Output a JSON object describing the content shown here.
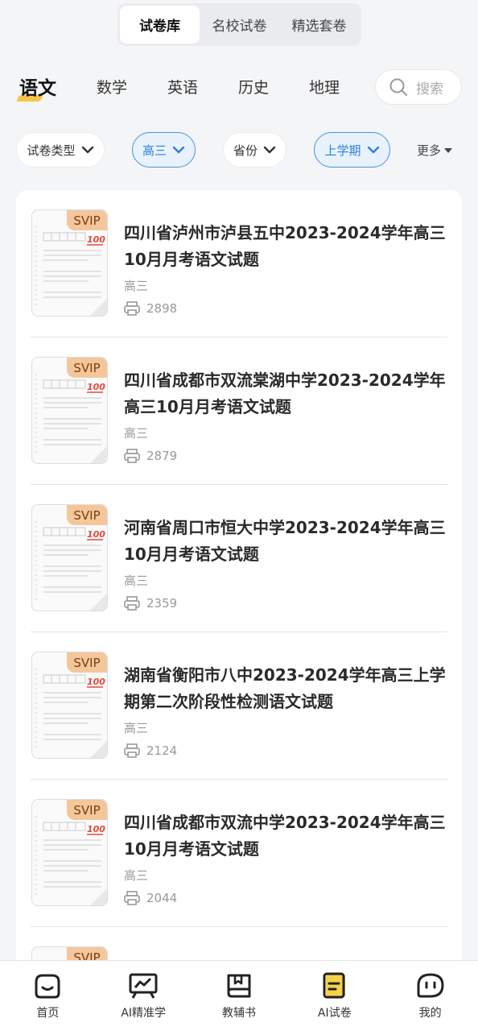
{
  "segment_tabs": [
    {
      "label": "试卷库",
      "active": true
    },
    {
      "label": "名校试卷",
      "active": false
    },
    {
      "label": "精选套卷",
      "active": false
    }
  ],
  "subjects": [
    {
      "label": "语文",
      "active": true
    },
    {
      "label": "数学",
      "active": false
    },
    {
      "label": "英语",
      "active": false
    },
    {
      "label": "历史",
      "active": false
    },
    {
      "label": "地理",
      "active": false
    }
  ],
  "search": {
    "placeholder": "搜索",
    "icon": "search-icon"
  },
  "filters": [
    {
      "label": "试卷类型",
      "selected": false
    },
    {
      "label": "高三",
      "selected": true
    },
    {
      "label": "省份",
      "selected": false
    },
    {
      "label": "上学期",
      "selected": true
    }
  ],
  "more_label": "更多",
  "colors": {
    "accent": "#2d7ed9",
    "badge": "#f3c79a",
    "underline": "#f6c544",
    "nav_highlight": "#f6d24a"
  },
  "papers": [
    {
      "badge": "SVIP",
      "title": "四川省泸州市泸县五中2023-2024学年高三10月月考语文试题",
      "grade": "高三",
      "count": "2898"
    },
    {
      "badge": "SVIP",
      "title": "四川省成都市双流棠湖中学2023-2024学年高三10月月考语文试题",
      "grade": "高三",
      "count": "2879"
    },
    {
      "badge": "SVIP",
      "title": "河南省周口市恒大中学2023-2024学年高三10月月考语文试题",
      "grade": "高三",
      "count": "2359"
    },
    {
      "badge": "SVIP",
      "title": "湖南省衡阳市八中2023-2024学年高三上学期第二次阶段性检测语文试题",
      "grade": "高三",
      "count": "2124"
    },
    {
      "badge": "SVIP",
      "title": "四川省成都市双流中学2023-2024学年高三10月月考语文试题",
      "grade": "高三",
      "count": "2044"
    },
    {
      "badge": "SVIP",
      "title": "",
      "grade": "",
      "count": ""
    }
  ],
  "bottom_nav": [
    {
      "label": "首页",
      "icon": "home-icon"
    },
    {
      "label": "AI精准学",
      "icon": "chart-board-icon"
    },
    {
      "label": "教辅书",
      "icon": "book-icon"
    },
    {
      "label": "AI试卷",
      "icon": "exam-paper-icon"
    },
    {
      "label": "我的",
      "icon": "profile-icon"
    }
  ]
}
